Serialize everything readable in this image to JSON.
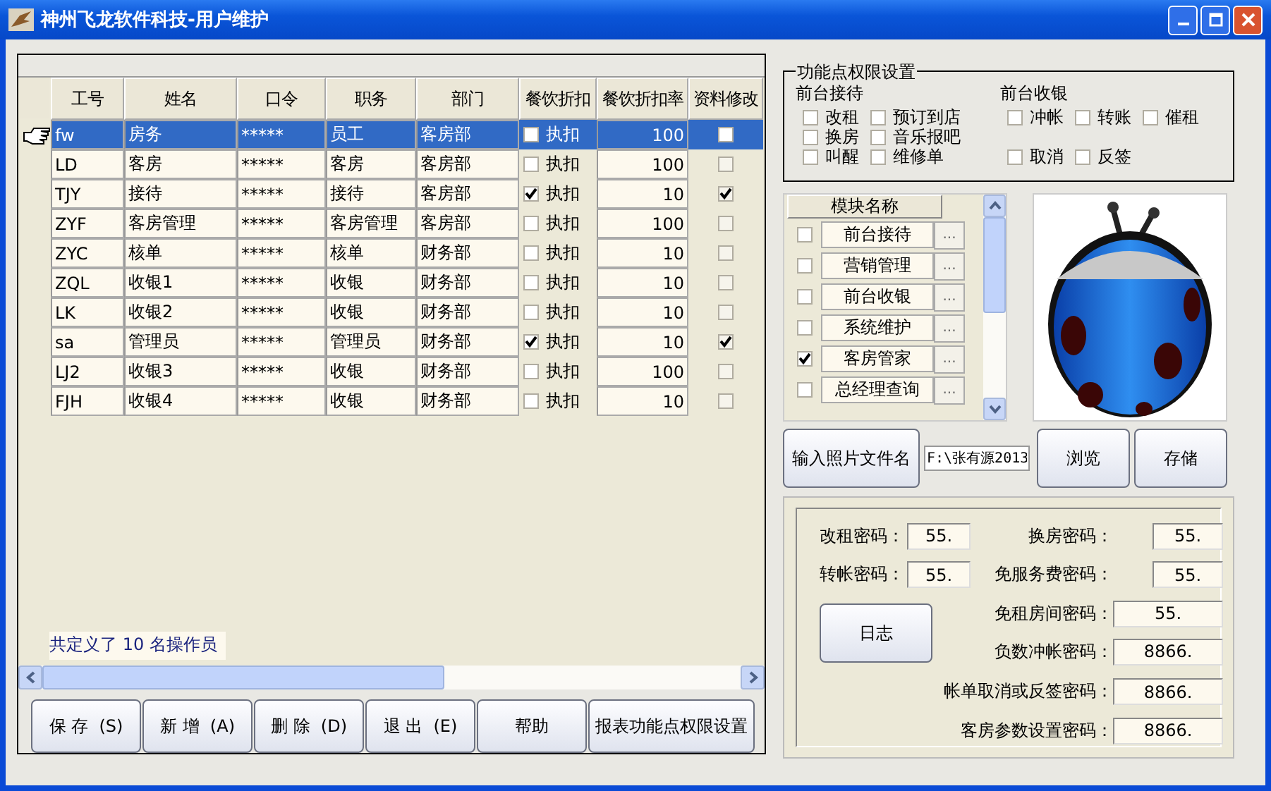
{
  "window": {
    "title": "神州飞龙软件科技-用户维护"
  },
  "table": {
    "columns": [
      "工号",
      "姓名",
      "口令",
      "职务",
      "部门",
      "餐饮折扣",
      "餐饮折扣率",
      "资料修改"
    ],
    "rows": [
      {
        "selected": true,
        "id": "fw",
        "name": "房务",
        "password": "*****",
        "position": "员工",
        "department": "客房部",
        "discount": false,
        "discount_label": "执扣",
        "rate": "100",
        "edit_allowed": false
      },
      {
        "selected": false,
        "id": "LD",
        "name": "客房",
        "password": "*****",
        "position": "客房",
        "department": "客房部",
        "discount": false,
        "discount_label": "执扣",
        "rate": "100",
        "edit_allowed": false
      },
      {
        "selected": false,
        "id": "TJY",
        "name": "接待",
        "password": "*****",
        "position": "接待",
        "department": "客房部",
        "discount": true,
        "discount_label": "执扣",
        "rate": "10",
        "edit_allowed": true
      },
      {
        "selected": false,
        "id": "ZYF",
        "name": "客房管理",
        "password": "*****",
        "position": "客房管理",
        "department": "客房部",
        "discount": false,
        "discount_label": "执扣",
        "rate": "100",
        "edit_allowed": false
      },
      {
        "selected": false,
        "id": "ZYC",
        "name": "核单",
        "password": "*****",
        "position": "核单",
        "department": "财务部",
        "discount": false,
        "discount_label": "执扣",
        "rate": "10",
        "edit_allowed": false
      },
      {
        "selected": false,
        "id": "ZQL",
        "name": "收银1",
        "password": "*****",
        "position": "收银",
        "department": "财务部",
        "discount": false,
        "discount_label": "执扣",
        "rate": "10",
        "edit_allowed": false
      },
      {
        "selected": false,
        "id": "LK",
        "name": "收银2",
        "password": "*****",
        "position": "收银",
        "department": "财务部",
        "discount": false,
        "discount_label": "执扣",
        "rate": "10",
        "edit_allowed": false
      },
      {
        "selected": false,
        "id": "sa",
        "name": "管理员",
        "password": "*****",
        "position": "管理员",
        "department": "财务部",
        "discount": true,
        "discount_label": "执扣",
        "rate": "10",
        "edit_allowed": true
      },
      {
        "selected": false,
        "id": "LJ2",
        "name": "收银3",
        "password": "*****",
        "position": "收银",
        "department": "财务部",
        "discount": false,
        "discount_label": "执扣",
        "rate": "100",
        "edit_allowed": false
      },
      {
        "selected": false,
        "id": "FJH",
        "name": "收银4",
        "password": "*****",
        "position": "收银",
        "department": "财务部",
        "discount": false,
        "discount_label": "执扣",
        "rate": "10",
        "edit_allowed": false
      }
    ]
  },
  "summary": "共定义了 10 名操作员",
  "buttons": [
    "保 存  (S)",
    "新 增  (A)",
    "删 除  (D)",
    "退 出  (E)",
    "帮助",
    "报表功能点权限设置"
  ],
  "permissions": {
    "title": "功能点权限设置",
    "groups": [
      {
        "title": "前台接待",
        "items": [
          {
            "label": "改租",
            "checked": false
          },
          {
            "label": "预订到店",
            "checked": false
          },
          {
            "label": "换房",
            "checked": false
          },
          {
            "label": "音乐报吧",
            "checked": false
          },
          {
            "label": "叫醒",
            "checked": false
          },
          {
            "label": "维修单",
            "checked": false
          }
        ]
      },
      {
        "title": "前台收银",
        "items": [
          {
            "label": "冲帐",
            "checked": false
          },
          {
            "label": "转账",
            "checked": false
          },
          {
            "label": "催租",
            "checked": false
          },
          {
            "label": "取消",
            "checked": false
          },
          {
            "label": "反签",
            "checked": false
          }
        ]
      }
    ]
  },
  "modules": {
    "header": "模块名称",
    "items": [
      {
        "label": "前台接待",
        "checked": false,
        "more": "..."
      },
      {
        "label": "营销管理",
        "checked": false,
        "more": "..."
      },
      {
        "label": "前台收银",
        "checked": false,
        "more": "..."
      },
      {
        "label": "系统维护",
        "checked": false,
        "more": "..."
      },
      {
        "label": "客房管家",
        "checked": true,
        "more": "..."
      },
      {
        "label": "总经理查询",
        "checked": false,
        "more": "..."
      }
    ]
  },
  "photo": {
    "kind": "picture",
    "button": "输入照片文件名",
    "path": "F:\\张有源2013",
    "browse": "浏览",
    "save": "存储"
  },
  "passwords": {
    "log_button": "日志",
    "fields": [
      {
        "label": "改租密码：",
        "value": "55."
      },
      {
        "label": "换房密码：",
        "value": "55."
      },
      {
        "label": "转帐密码：",
        "value": "55."
      },
      {
        "label": "免服务费密码：",
        "value": "55."
      },
      {
        "label": "免租房间密码：",
        "value": "55."
      },
      {
        "label": "负数冲帐密码：",
        "value": "8866."
      },
      {
        "label": "帐单取消或反签密码：",
        "value": "8866."
      },
      {
        "label": "客房参数设置密码：",
        "value": "8866."
      }
    ]
  }
}
